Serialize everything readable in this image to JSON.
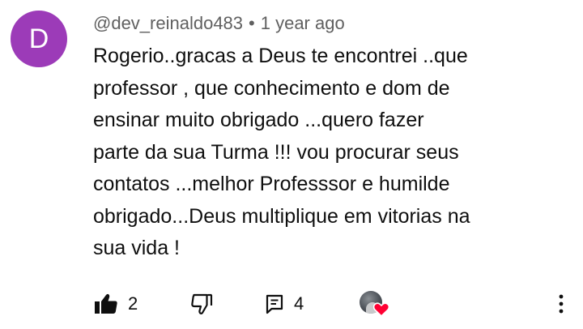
{
  "comment": {
    "avatar_letter": "D",
    "avatar_color": "#9c3bb8",
    "author": "@dev_reinaldo483",
    "separator": "•",
    "timestamp": "1 year ago",
    "text_lines": [
      "Rogerio..gracas a Deus te encontrei ..que",
      "professor , que conhecimento e dom de",
      "ensinar muito obrigado ...quero fazer",
      "parte da sua Turma !!! vou procurar seus",
      "contatos ...melhor Professsor e humilde",
      "obrigado...Deus multiplique em vitorias na",
      "sua vida !"
    ]
  },
  "actions": {
    "like_icon": "thumbs-up-filled-icon",
    "like_count": "2",
    "dislike_icon": "thumbs-down-outline-icon",
    "replies_icon": "comment-replies-icon",
    "reply_count": "4",
    "creator_heart_icon": "creator-heart-icon",
    "heart_color": "#ff0033",
    "more_icon": "more-vertical-icon"
  }
}
